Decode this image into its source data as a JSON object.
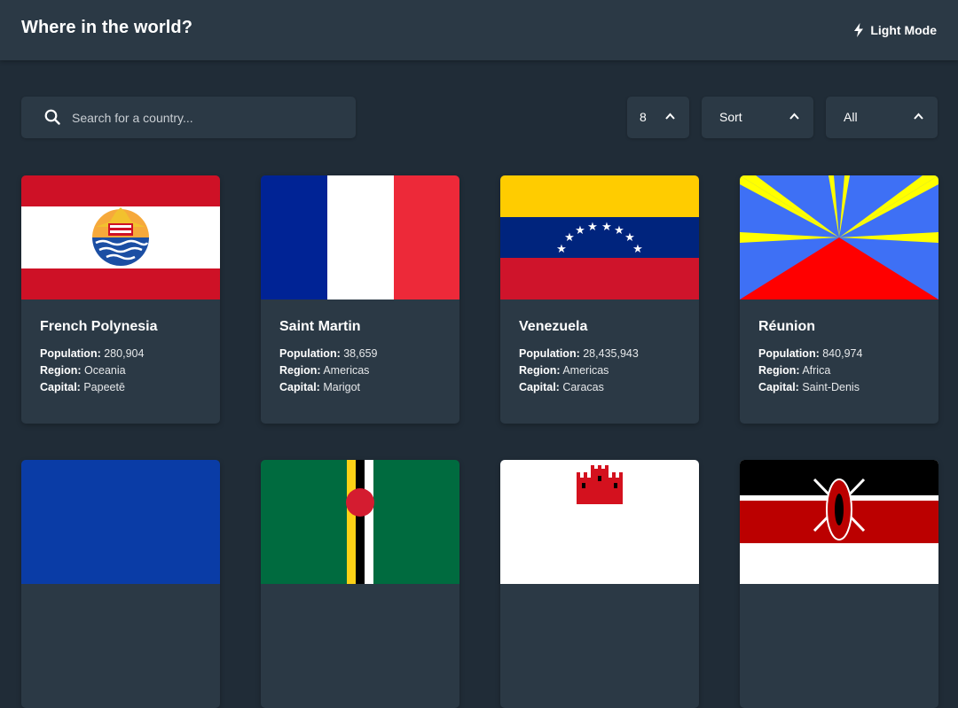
{
  "header": {
    "title": "Where in the world?",
    "theme_toggle_label": "Light Mode"
  },
  "controls": {
    "search_placeholder": "Search for a country...",
    "count_value": "8",
    "sort_value": "Sort",
    "region_value": "All"
  },
  "labels": {
    "population": "Population:",
    "region": "Region:",
    "capital": "Capital:"
  },
  "countries": [
    {
      "name": "French Polynesia",
      "population": "280,904",
      "region": "Oceania",
      "capital": "Papeetē"
    },
    {
      "name": "Saint Martin",
      "population": "38,659",
      "region": "Americas",
      "capital": "Marigot"
    },
    {
      "name": "Venezuela",
      "population": "28,435,943",
      "region": "Americas",
      "capital": "Caracas"
    },
    {
      "name": "Réunion",
      "population": "840,974",
      "region": "Africa",
      "capital": "Saint-Denis"
    }
  ],
  "colors": {
    "background": "#202c37",
    "element": "#2b3945",
    "text": "#ffffff"
  }
}
